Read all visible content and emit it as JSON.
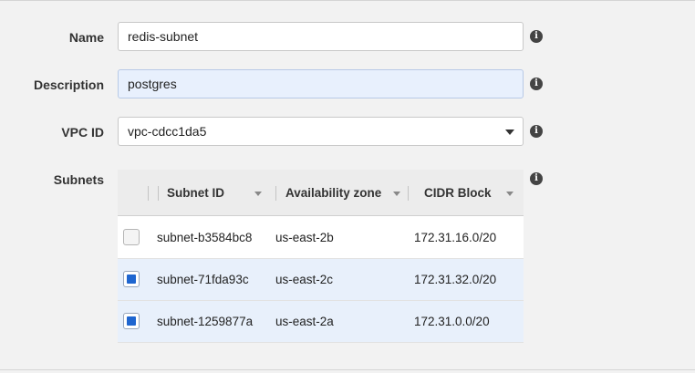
{
  "form": {
    "name": {
      "label": "Name",
      "value": "redis-subnet"
    },
    "description": {
      "label": "Description",
      "value": "postgres"
    },
    "vpc": {
      "label": "VPC ID",
      "value": "vpc-cdcc1da5"
    },
    "subnets": {
      "label": "Subnets"
    },
    "info_glyph": "i"
  },
  "subnet_table": {
    "columns": [
      "Subnet ID",
      "Availability zone",
      "CIDR Block"
    ],
    "rows": [
      {
        "subnet_id": "subnet-b3584bc8",
        "zone": "us-east-2b",
        "cidr": "172.31.16.0/20",
        "checked": false
      },
      {
        "subnet_id": "subnet-71fda93c",
        "zone": "us-east-2c",
        "cidr": "172.31.32.0/20",
        "checked": true
      },
      {
        "subnet_id": "subnet-1259877a",
        "zone": "us-east-2a",
        "cidr": "172.31.0.0/20",
        "checked": true
      }
    ]
  },
  "icons": {
    "info": "info-icon",
    "dropdown": "chevron-down-icon",
    "sort": "sort-caret-icon"
  },
  "colors": {
    "selected_row": "#e8f0fb",
    "checkbox_checked": "#1f66d0",
    "focused_field": "#e8f0fd"
  }
}
